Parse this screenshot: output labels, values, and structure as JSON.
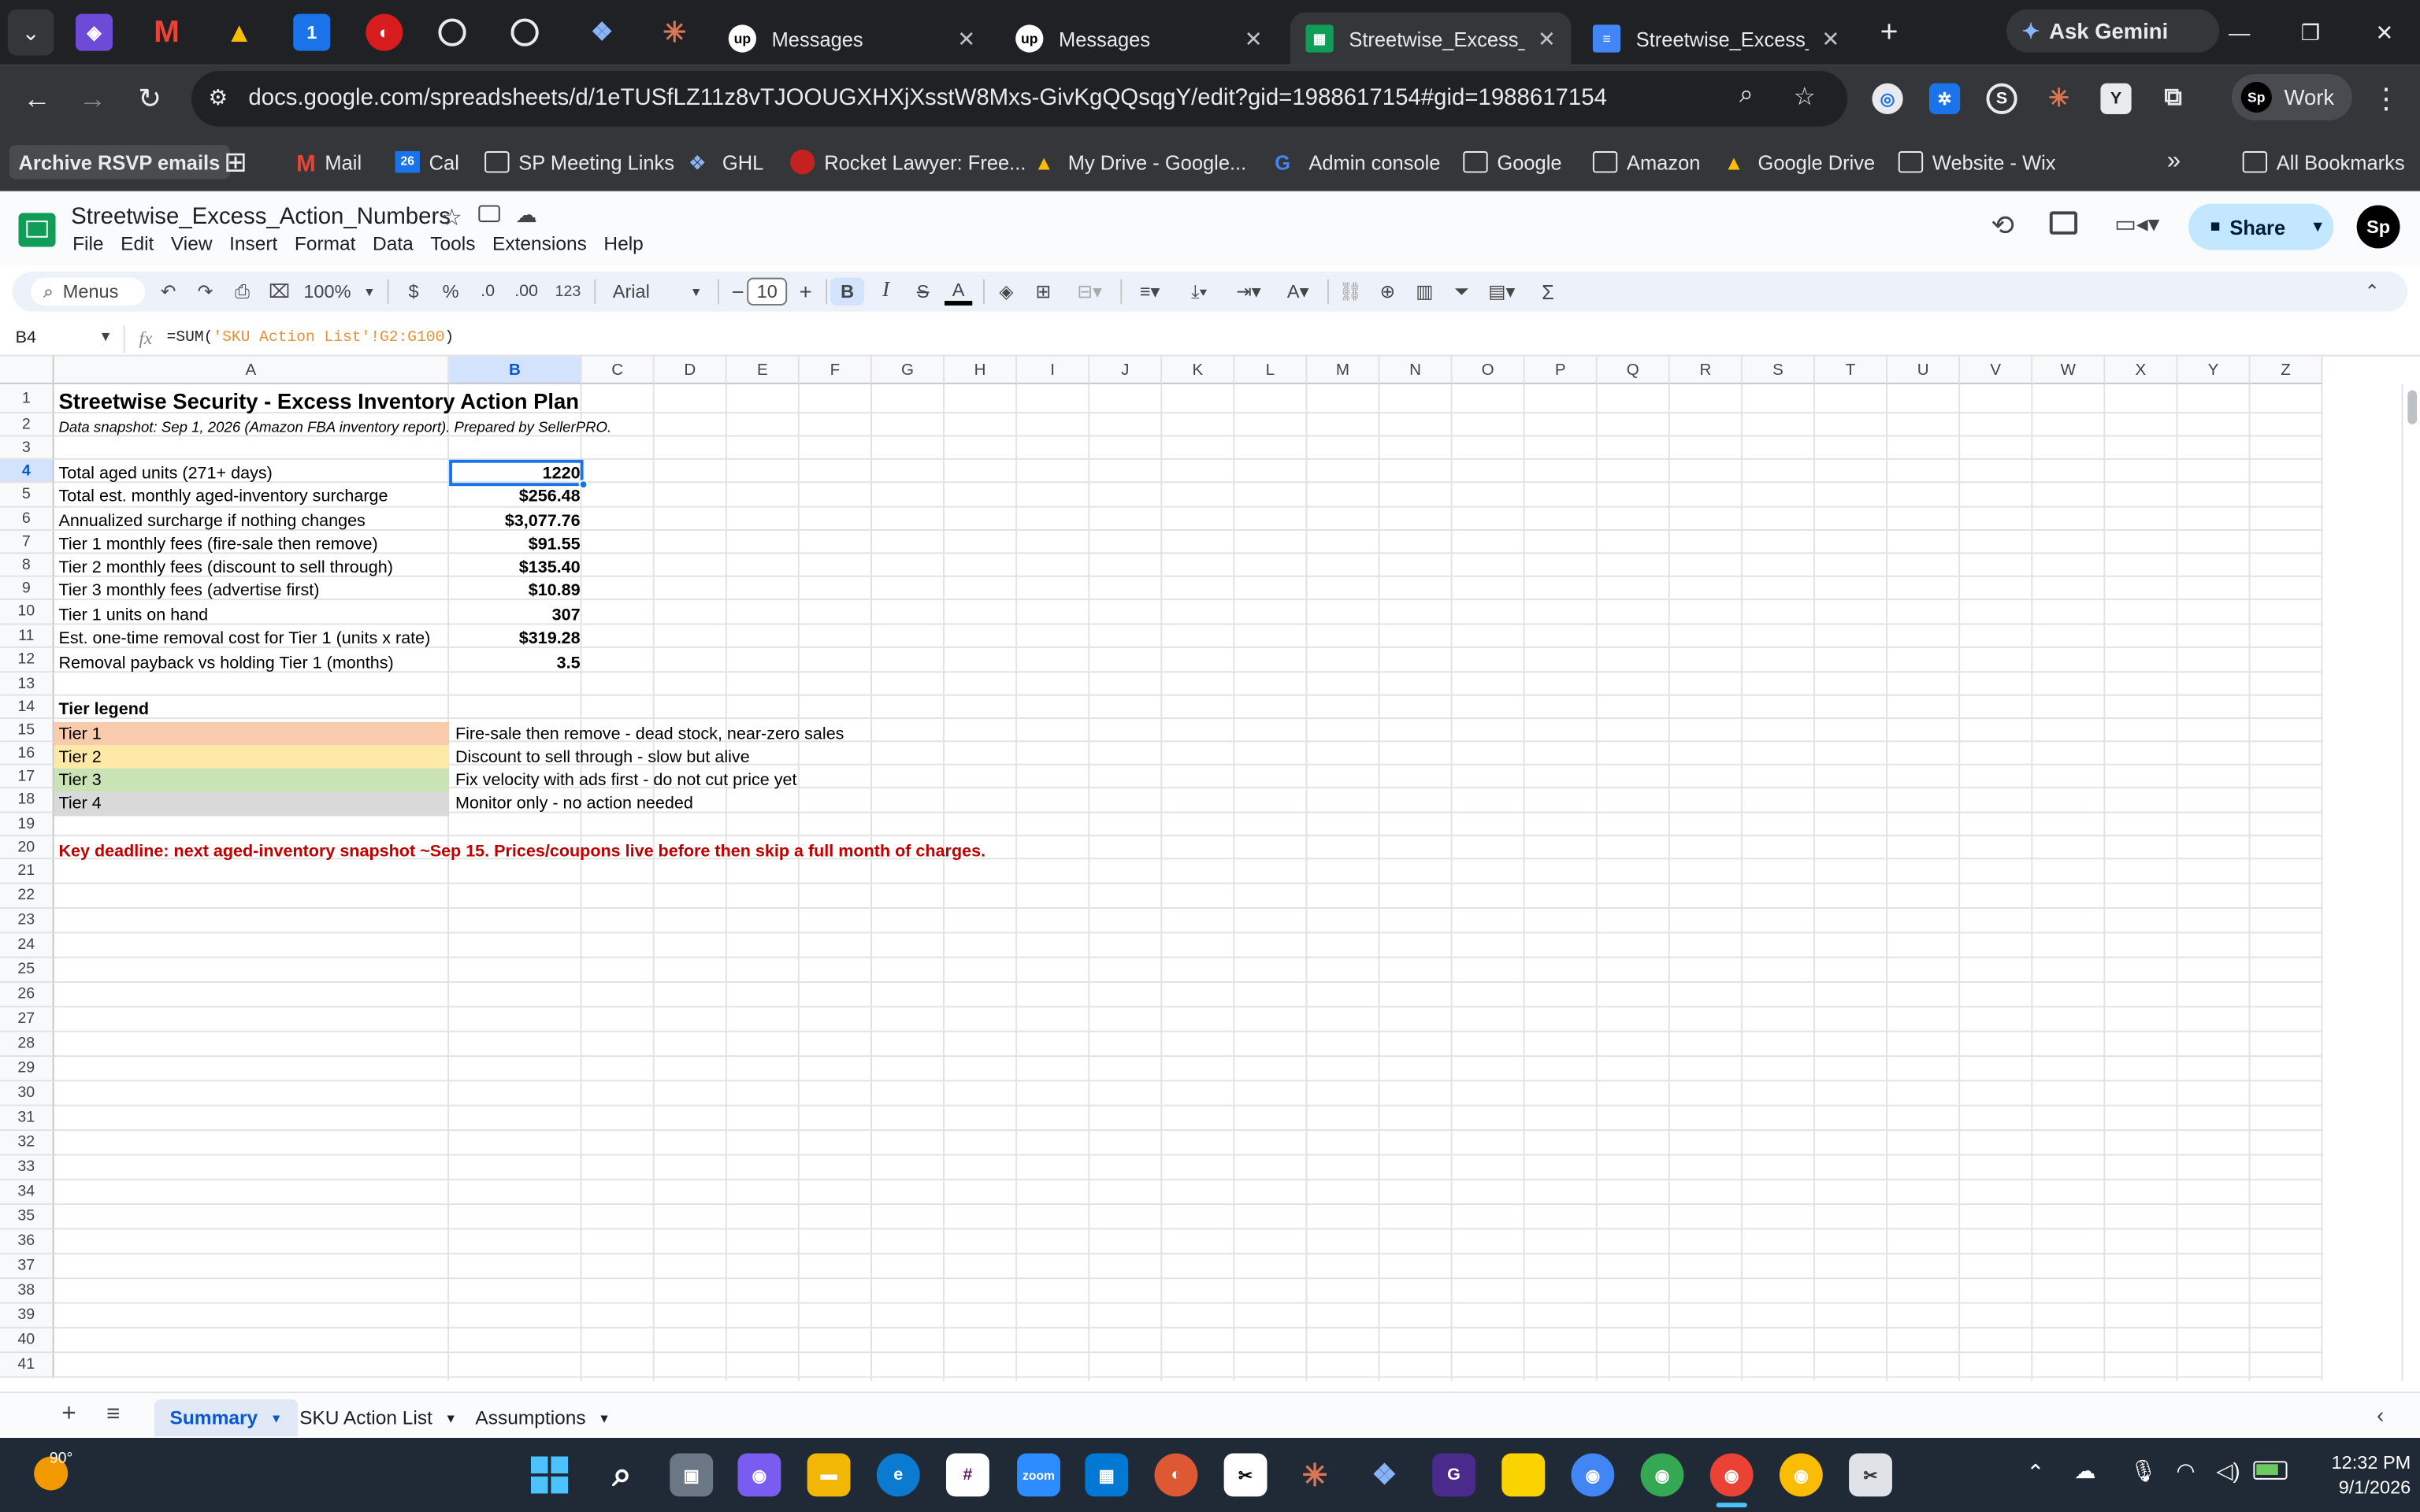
{
  "browser": {
    "tabs": [
      {
        "label": "Messages",
        "icon": "upwork-icon"
      },
      {
        "label": "Messages",
        "icon": "upwork-icon"
      },
      {
        "label": "Streetwise_Excess_Ac",
        "icon": "sheets-icon"
      },
      {
        "label": "Streetwise_Excess_In",
        "icon": "docs-icon"
      }
    ],
    "ask_gemini": "Ask Gemini",
    "url": "docs.google.com/spreadsheets/d/1eTUSfLZ11z8vTJOOUGXHXjXsstW8Mxs-GivKgQQsqgY/edit?gid=1988617154#gid=1988617154",
    "profile_label": "Work",
    "bookmarks": [
      "Archive RSVP emails",
      "Mail",
      "Cal",
      "SP Meeting Links",
      "GHL",
      "Rocket Lawyer: Free...",
      "My Drive - Google...",
      "Admin console",
      "Google",
      "Amazon",
      "Google Drive",
      "Website - Wix",
      "All Bookmarks"
    ],
    "cal_badge": "26"
  },
  "doc": {
    "title": "Streetwise_Excess_Action_Numbers",
    "menus": [
      "File",
      "Edit",
      "View",
      "Insert",
      "Format",
      "Data",
      "Tools",
      "Extensions",
      "Help"
    ],
    "share": "Share",
    "avatar": "Sp"
  },
  "toolbar": {
    "menus_search": "Menus",
    "zoom": "100%",
    "currency": "$",
    "percent": "%",
    "dec_less": ".0",
    "dec_more": ".00",
    "number_fmt": "123",
    "font": "Arial",
    "font_size": "10",
    "bold": "B",
    "italic": "I",
    "text_color": "A",
    "sum": "Σ"
  },
  "formula_bar": {
    "cell_ref": "B4",
    "fx": "fx",
    "formula_prefix": "=SUM(",
    "formula_ref": "'SKU Action List'!G2:G100",
    "formula_suffix": ")"
  },
  "columns": [
    "A",
    "B",
    "C",
    "D",
    "E",
    "F",
    "G",
    "H",
    "I",
    "J",
    "K",
    "L",
    "M",
    "N",
    "O",
    "P",
    "Q",
    "R",
    "S",
    "T",
    "U",
    "V",
    "W",
    "X",
    "Y",
    "Z"
  ],
  "rows": [
    "1",
    "2",
    "3",
    "4",
    "5",
    "6",
    "7",
    "8",
    "9",
    "10",
    "11",
    "12",
    "13",
    "14",
    "15",
    "16",
    "17",
    "18",
    "19",
    "20",
    "21",
    "22",
    "23",
    "24",
    "25",
    "26",
    "27",
    "28",
    "29",
    "30",
    "31",
    "32",
    "33",
    "34",
    "35",
    "36",
    "37",
    "38",
    "39",
    "40",
    "41"
  ],
  "sheet": {
    "title": "Streetwise Security - Excess Inventory Action Plan",
    "subtitle": "Data snapshot: Sep 1, 2026 (Amazon FBA inventory report). Prepared by SellerPRO.",
    "metrics": [
      {
        "label": "Total aged units (271+ days)",
        "value": "1220"
      },
      {
        "label": "Total est. monthly aged-inventory surcharge",
        "value": "$256.48"
      },
      {
        "label": "Annualized surcharge if nothing changes",
        "value": "$3,077.76"
      },
      {
        "label": "Tier 1 monthly fees (fire-sale then remove)",
        "value": "$91.55"
      },
      {
        "label": "Tier 2 monthly fees (discount to sell through)",
        "value": "$135.40"
      },
      {
        "label": "Tier 3 monthly fees (advertise first)",
        "value": "$10.89"
      },
      {
        "label": "Tier 1 units on hand",
        "value": "307"
      },
      {
        "label": "Est. one-time removal cost for Tier 1 (units x rate)",
        "value": "$319.28"
      },
      {
        "label": "Removal payback vs holding Tier 1 (months)",
        "value": "3.5"
      }
    ],
    "legend_heading": "Tier legend",
    "legend": [
      {
        "tier": "Tier 1",
        "desc": "Fire-sale then remove - dead stock, near-zero sales",
        "color": "#f9cbad"
      },
      {
        "tier": "Tier 2",
        "desc": "Discount to sell through - slow but alive",
        "color": "#fde8a6"
      },
      {
        "tier": "Tier 3",
        "desc": "Fix velocity with ads first - do not cut price yet",
        "color": "#c9e3b4"
      },
      {
        "tier": "Tier 4",
        "desc": "Monitor only - no action needed",
        "color": "#d9d9d9"
      }
    ],
    "deadline": "Key deadline: next aged-inventory snapshot ~Sep 15. Prices/coupons live before then skip a full month of charges.",
    "deadline_color": "#c00000"
  },
  "sheet_tabs": [
    {
      "label": "Summary",
      "active": true
    },
    {
      "label": "SKU Action List",
      "active": false
    },
    {
      "label": "Assumptions",
      "active": false
    }
  ],
  "taskbar": {
    "weather_temp": "90°",
    "time": "12:32 PM",
    "date": "9/1/2026"
  }
}
